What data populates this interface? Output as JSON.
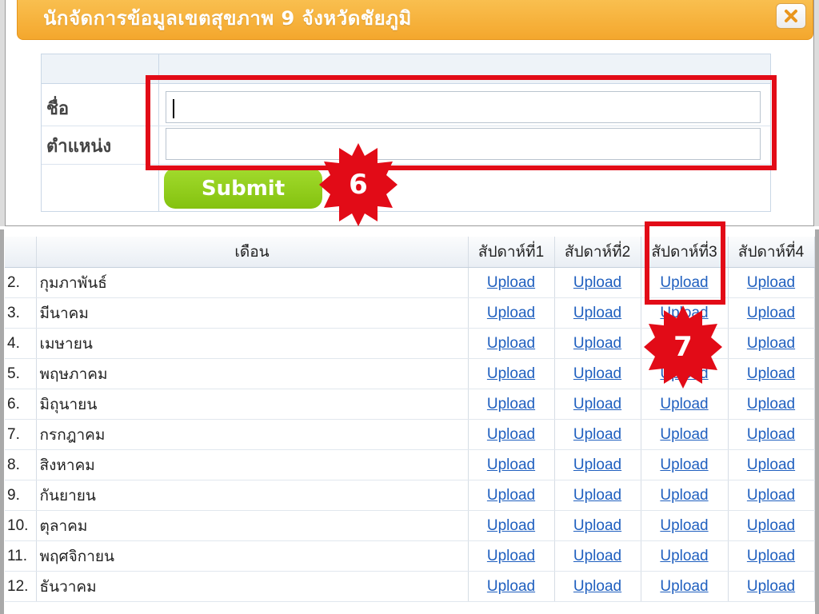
{
  "dialog": {
    "title": "นักจัดการข้อมูลเขตสุขภาพ 9 จังหวัดชัยภูมิ",
    "close_icon": "close-icon"
  },
  "form": {
    "name_label": "ชื่อ",
    "name_value": "",
    "position_label": "ตำแหน่ง",
    "position_value": "",
    "submit_label": "Submit"
  },
  "annotations": {
    "step6": "6",
    "step7": "7",
    "highlight_color": "#e20b17"
  },
  "table": {
    "headers": [
      "",
      "เดือน",
      "สัปดาห์ที่1",
      "สัปดาห์ที่2",
      "สัปดาห์ที่3",
      "สัปดาห์ที่4"
    ],
    "upload_label": "Upload",
    "rows": [
      {
        "num": "2.",
        "month": "กุมภาพันธ์"
      },
      {
        "num": "3.",
        "month": "มีนาคม"
      },
      {
        "num": "4.",
        "month": "เมษายน"
      },
      {
        "num": "5.",
        "month": "พฤษภาคม"
      },
      {
        "num": "6.",
        "month": "มิถุนายน"
      },
      {
        "num": "7.",
        "month": "กรกฎาคม"
      },
      {
        "num": "8.",
        "month": "สิงหาคม"
      },
      {
        "num": "9.",
        "month": "กันยายน"
      },
      {
        "num": "10.",
        "month": "ตุลาคม"
      },
      {
        "num": "11.",
        "month": "พฤศจิกายน"
      },
      {
        "num": "12.",
        "month": "ธันวาคม"
      }
    ]
  },
  "colors": {
    "title_bar": "#f4a72d",
    "submit": "#84c20f",
    "link": "#1f5fbf"
  }
}
